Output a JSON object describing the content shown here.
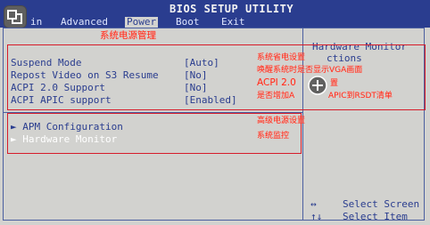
{
  "header": {
    "title": "BIOS SETUP UTILITY",
    "tabs": [
      {
        "label": "in"
      },
      {
        "label": "Advanced"
      },
      {
        "label": "Power"
      },
      {
        "label": "Boot"
      },
      {
        "label": "Exit"
      }
    ],
    "active_tab": "Power"
  },
  "settings": [
    {
      "label": "Suspend Mode",
      "value": "[Auto]"
    },
    {
      "label": "Repost Video on S3 Resume",
      "value": "[No]"
    },
    {
      "label": "ACPI 2.0 Support",
      "value": "[No]"
    },
    {
      "label": "ACPI APIC support",
      "value": "[Enabled]"
    }
  ],
  "submenus": [
    {
      "label": "APM Configuration"
    },
    {
      "label": "Hardware Monitor"
    }
  ],
  "help_panel": {
    "title_line1": "Hardware Monitor",
    "title_line2": "ctions",
    "keys": [
      {
        "key": "↔",
        "desc": "Select Screen"
      },
      {
        "key": "↑↓",
        "desc": "Select Item"
      }
    ]
  },
  "annotations": {
    "power_mgmt": "系统电源管理",
    "sleep_mode": "系统省电设置",
    "vga_wake": "唤醒系统时是否显示VGA画面",
    "acpi2": "ACPI 2.0",
    "acpi2_suffix": "置",
    "apic_prefix": "是否增加A",
    "apic_suffix": "APIC到RSDT清单",
    "advanced_power": "高级电源设置",
    "system_monitor": "系统监控"
  },
  "colors": {
    "bios_blue": "#2a3d8f",
    "bios_gray": "#d2d2cf",
    "annotation_red": "#ff2a1a"
  },
  "icons": {
    "app_badge": "logo-badge-icon",
    "cursor": "plus-cursor-icon"
  }
}
